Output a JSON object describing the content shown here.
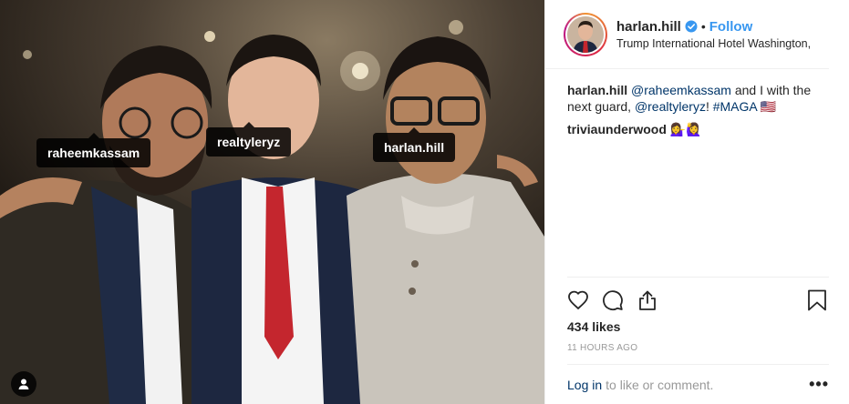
{
  "photo": {
    "tags": [
      "raheemkassam",
      "realtyleryz",
      "harlan.hill"
    ]
  },
  "header": {
    "username": "harlan.hill",
    "separator": "•",
    "follow_label": "Follow",
    "location": "Trump International Hotel Washington, ...",
    "verified_icon": "verified-badge-icon"
  },
  "caption": {
    "username": "harlan.hill",
    "mention_1": "@raheemkassam",
    "text_1": " and I with the next guard, ",
    "mention_2": "@realtyleryz",
    "text_2": "! ",
    "hashtag": "#MAGA",
    "flag": "🇺🇸"
  },
  "comment": {
    "username": "triviaunderwood",
    "emojis": "💁‍♀️🙋‍♀️"
  },
  "actions": {
    "icons": [
      "heart-icon",
      "comment-icon",
      "share-icon",
      "bookmark-icon"
    ]
  },
  "likes_label": "434 likes",
  "timestamp": "11 HOURS AGO",
  "footer": {
    "login_label": "Log in",
    "rest_text": "to like or comment.",
    "more_label": "•••"
  },
  "colors": {
    "accent": "#3897f0",
    "link": "#003569",
    "muted": "#999999"
  }
}
